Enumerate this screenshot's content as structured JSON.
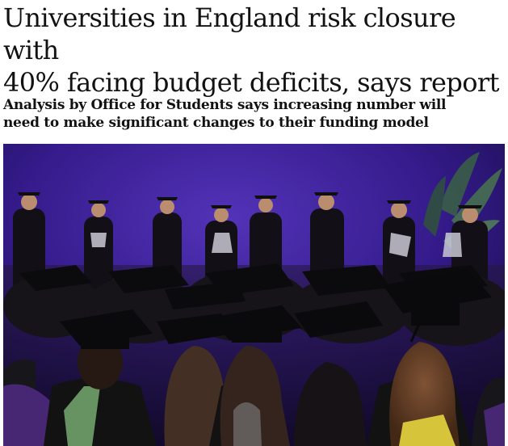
{
  "article": {
    "headline_line1": "Universities in England risk closure with",
    "headline_line2": "40% facing budget deficits, says report",
    "standfirst_line1": "Analysis by Office for Students says increasing number will",
    "standfirst_line2": "need to make significant changes to their funding model"
  },
  "image": {
    "subject": "graduates in mortarboards and gowns at a ceremony",
    "background_color": "#3b1f9a",
    "gown_color": "#141414",
    "hood_colors": [
      "#4e2a7d",
      "#6fa06a",
      "#e9d640",
      "#d8d8e8"
    ]
  }
}
